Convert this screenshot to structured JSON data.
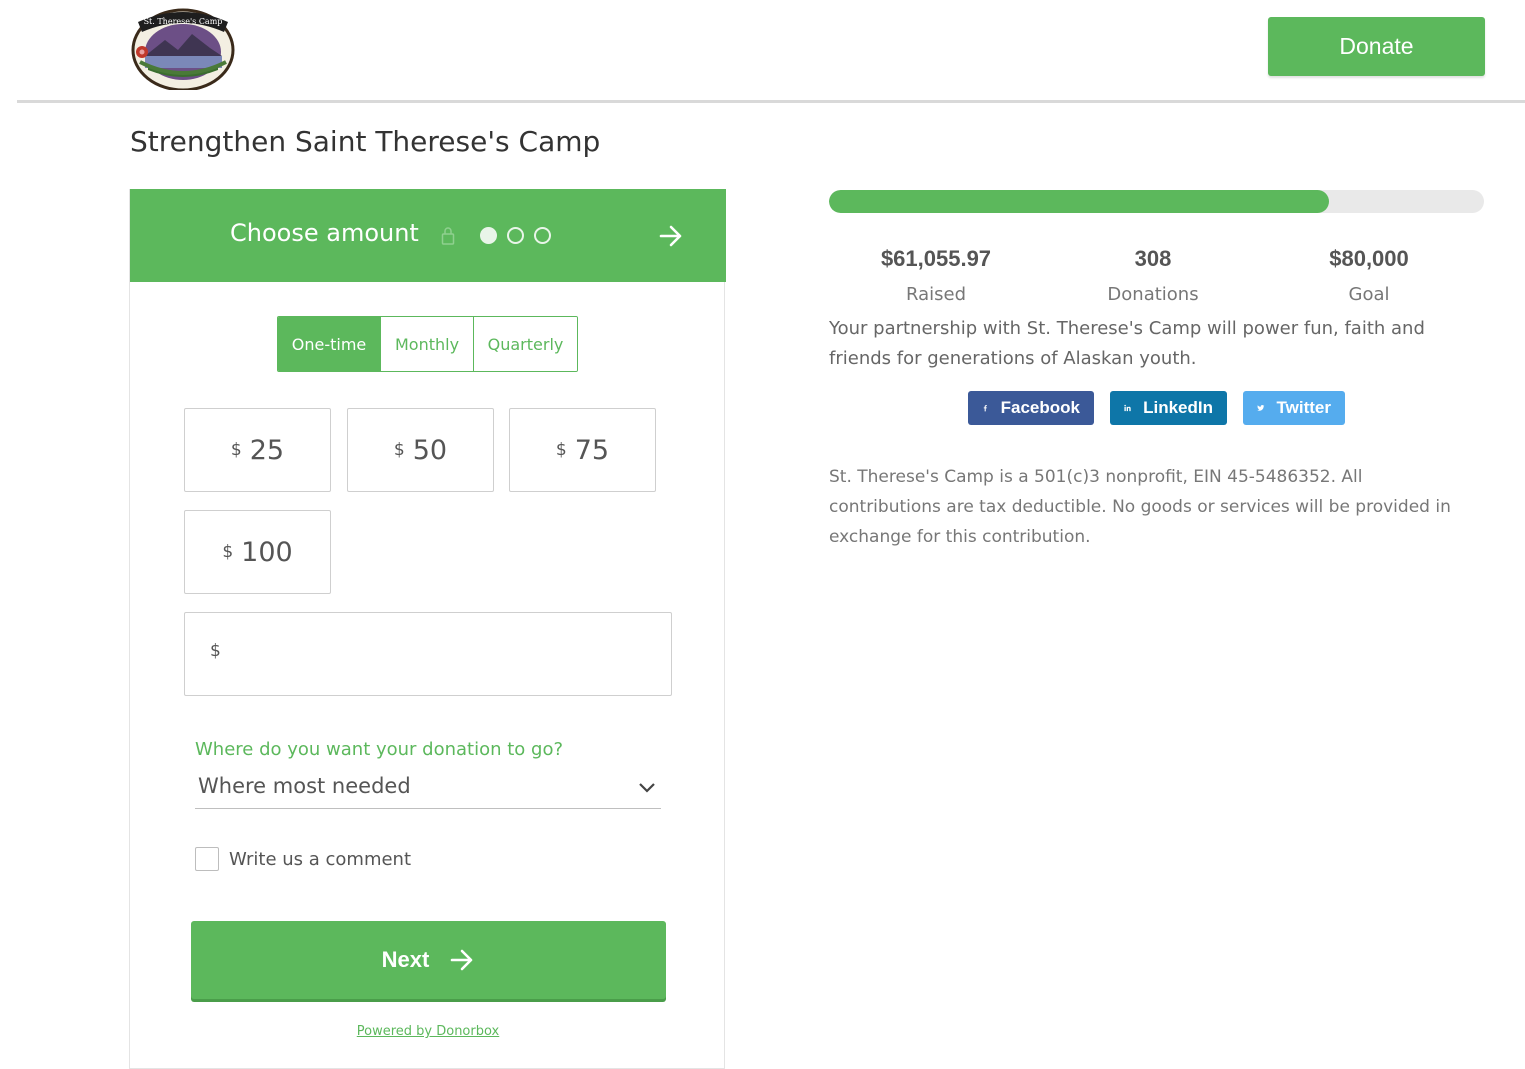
{
  "header": {
    "logo_text": "St. Therese's Camp",
    "donate_label": "Donate"
  },
  "page": {
    "title": "Strengthen Saint Therese's Camp"
  },
  "form": {
    "step_title": "Choose amount",
    "steps_total": 3,
    "current_step": 1,
    "frequency": {
      "options": [
        "One-time",
        "Monthly",
        "Quarterly"
      ],
      "selected": "One-time"
    },
    "currency_symbol": "$",
    "amounts": [
      "25",
      "50",
      "75",
      "100"
    ],
    "custom_amount_value": "",
    "destination": {
      "label": "Where do you want your donation to go?",
      "selected": "Where most needed"
    },
    "comment_label": "Write us a comment",
    "comment_checked": false,
    "next_label": "Next",
    "powered_by": "Powered by Donorbox"
  },
  "campaign": {
    "progress_fraction": 0.763,
    "raised_value": "$61,055.97",
    "raised_label": "Raised",
    "donations_value": "308",
    "donations_label": "Donations",
    "goal_value": "$80,000",
    "goal_label": "Goal",
    "description": "Your partnership with St. Therese's Camp will power fun, faith and friends for generations of Alaskan youth.",
    "share": {
      "facebook": "Facebook",
      "linkedin": "LinkedIn",
      "twitter": "Twitter"
    },
    "legal": "St. Therese's Camp is a 501(c)3 nonprofit, EIN 45-5486352. All contributions are tax deductible. No goods or services will be provided in exchange for this contribution."
  },
  "colors": {
    "accent": "#5cb85c",
    "facebook": "#3b5998",
    "linkedin": "#0e76a8",
    "twitter": "#55acee"
  }
}
